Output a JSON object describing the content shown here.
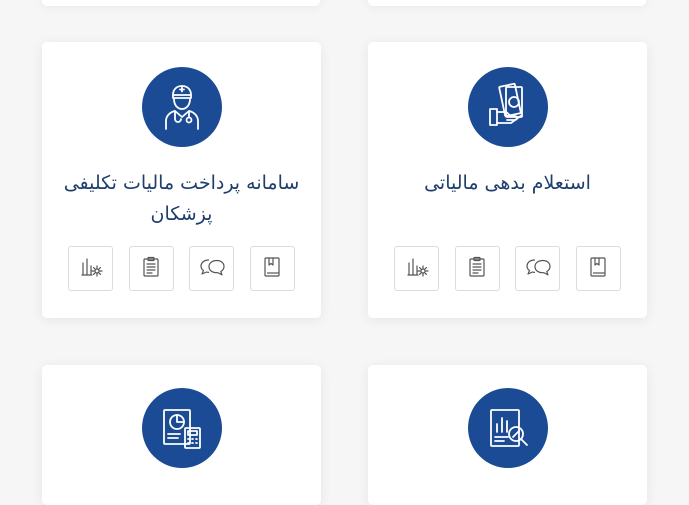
{
  "cards": [
    {
      "icon": "money-hand-icon",
      "title": "استعلام بدهی مالیاتی"
    },
    {
      "icon": "doctor-icon",
      "title": "سامانه پرداخت مالیات تکلیفی پزشکان"
    },
    {
      "icon": "tax-report-icon",
      "title": ""
    },
    {
      "icon": "accounting-calculator-icon",
      "title": ""
    }
  ],
  "action_icons": [
    "book-icon",
    "chat-icon",
    "clipboard-icon",
    "chart-settings-icon"
  ],
  "colors": {
    "accent": "#1b4b94",
    "title": "#1f3e6e",
    "background": "#f6f6f6"
  }
}
